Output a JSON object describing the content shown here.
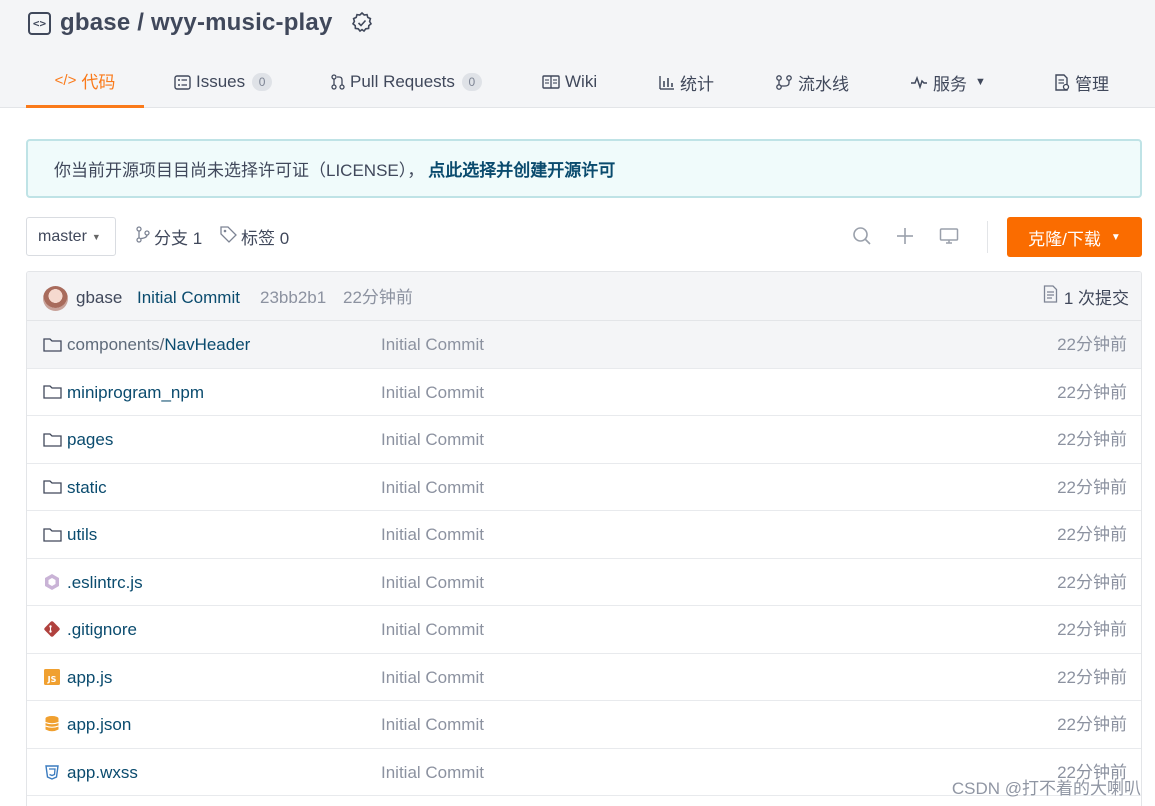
{
  "repo": {
    "owner": "gbase",
    "separator": " / ",
    "name": "wyy-music-play",
    "icon": "code-bracket-icon",
    "recommend_icon": "award-badge-icon"
  },
  "tabs": [
    {
      "label": "代码",
      "icon": "code-icon",
      "active": true
    },
    {
      "label": "Issues",
      "icon": "issues-icon",
      "count": "0"
    },
    {
      "label": "Pull Requests",
      "icon": "pull-request-icon",
      "count": "0"
    },
    {
      "label": "Wiki",
      "icon": "book-icon"
    },
    {
      "label": "统计",
      "icon": "bar-chart-icon"
    },
    {
      "label": "流水线",
      "icon": "pipeline-icon"
    },
    {
      "label": "服务",
      "icon": "pulse-icon",
      "dropdown": true
    },
    {
      "label": "管理",
      "icon": "settings-doc-icon"
    }
  ],
  "notice": {
    "text": "你当前开源项目目尚未选择许可证（LICENSE），",
    "link": "点此选择并创建开源许可"
  },
  "toolbar": {
    "branch": "master",
    "branches_label": "分支 1",
    "tags_label": "标签 0",
    "clone_label": "克隆/下载"
  },
  "last_commit": {
    "author": "gbase",
    "message": "Initial Commit",
    "sha": "23bb2b1",
    "time": "22分钟前",
    "commits_label": "1 次提交"
  },
  "files": [
    {
      "prefix": "components/",
      "name": "NavHeader",
      "type": "folder",
      "message": "Initial Commit",
      "time": "22分钟前"
    },
    {
      "prefix": "",
      "name": "miniprogram_npm",
      "type": "folder",
      "message": "Initial Commit",
      "time": "22分钟前"
    },
    {
      "prefix": "",
      "name": "pages",
      "type": "folder",
      "message": "Initial Commit",
      "time": "22分钟前"
    },
    {
      "prefix": "",
      "name": "static",
      "type": "folder",
      "message": "Initial Commit",
      "time": "22分钟前"
    },
    {
      "prefix": "",
      "name": "utils",
      "type": "folder",
      "message": "Initial Commit",
      "time": "22分钟前"
    },
    {
      "prefix": "",
      "name": ".eslintrc.js",
      "type": "eslint",
      "message": "Initial Commit",
      "time": "22分钟前"
    },
    {
      "prefix": "",
      "name": ".gitignore",
      "type": "git",
      "message": "Initial Commit",
      "time": "22分钟前"
    },
    {
      "prefix": "",
      "name": "app.js",
      "type": "js",
      "message": "Initial Commit",
      "time": "22分钟前"
    },
    {
      "prefix": "",
      "name": "app.json",
      "type": "json",
      "message": "Initial Commit",
      "time": "22分钟前"
    },
    {
      "prefix": "",
      "name": "app.wxss",
      "type": "css",
      "message": "Initial Commit",
      "time": "22分钟前"
    }
  ],
  "watermark": "CSDN @打不着的大喇叭",
  "colors": {
    "accent": "#fa6c00",
    "link": "#0a4b6e",
    "notice_bg": "#f0fbfb"
  }
}
